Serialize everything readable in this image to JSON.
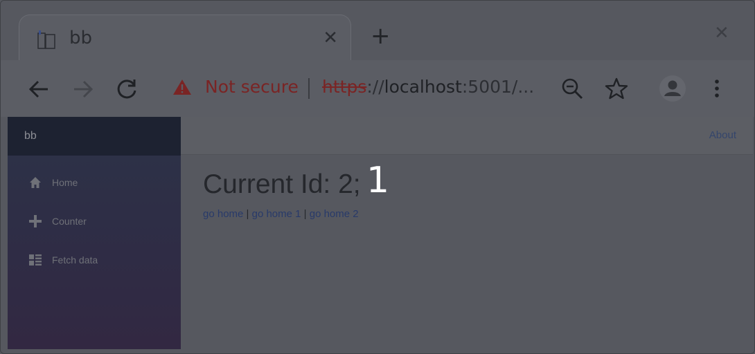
{
  "browser": {
    "tab": {
      "title": "bb",
      "close": "✕"
    },
    "new_tab": "+",
    "window_close": "✕",
    "security_text": "Not secure",
    "url": {
      "scheme": "https",
      "separator": "://",
      "host": "localhost",
      "rest": ":5001/..."
    }
  },
  "sidebar": {
    "brand": "bb",
    "items": [
      {
        "label": "Home",
        "icon": "home-icon"
      },
      {
        "label": "Counter",
        "icon": "plus-icon"
      },
      {
        "label": "Fetch data",
        "icon": "list-icon"
      }
    ]
  },
  "topbar": {
    "about": "About"
  },
  "main": {
    "heading": "Current Id: 2;",
    "links": [
      "go home",
      "go home 1",
      "go home 2"
    ],
    "link_separator": " | "
  },
  "overlay_number": "1",
  "colors": {
    "accent_link": "#283a6a",
    "warning": "#7a2424",
    "overlay_dim": "#56585f"
  }
}
